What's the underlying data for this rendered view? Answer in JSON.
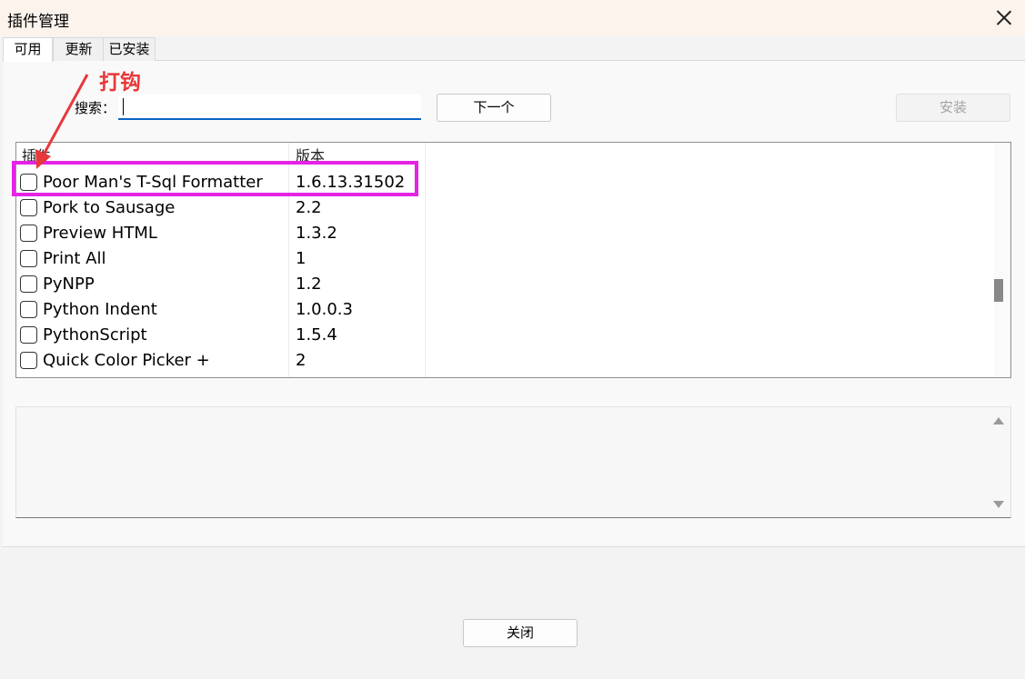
{
  "window": {
    "title": "插件管理"
  },
  "tabs": [
    {
      "label": "可用",
      "active": true
    },
    {
      "label": "更新",
      "active": false
    },
    {
      "label": "已安装",
      "active": false
    }
  ],
  "search": {
    "label": "搜索：",
    "value": ""
  },
  "buttons": {
    "next": "下一个",
    "install": "安装",
    "close": "关闭"
  },
  "table": {
    "columns": [
      "插件",
      "版本"
    ],
    "rows": [
      {
        "name": "Poor Man's T-Sql Formatter",
        "version": "1.6.13.31502",
        "checked": false
      },
      {
        "name": "Pork to Sausage",
        "version": "2.2",
        "checked": false
      },
      {
        "name": "Preview HTML",
        "version": "1.3.2",
        "checked": false
      },
      {
        "name": "Print All",
        "version": "1",
        "checked": false
      },
      {
        "name": "PyNPP",
        "version": "1.2",
        "checked": false
      },
      {
        "name": "Python Indent",
        "version": "1.0.0.3",
        "checked": false
      },
      {
        "name": "PythonScript",
        "version": "1.5.4",
        "checked": false
      },
      {
        "name": "Quick Color Picker +",
        "version": "2",
        "checked": false
      }
    ]
  },
  "annotation": {
    "text": "打钩",
    "highlight_color": "#e423e4",
    "text_color": "#e8383b"
  }
}
